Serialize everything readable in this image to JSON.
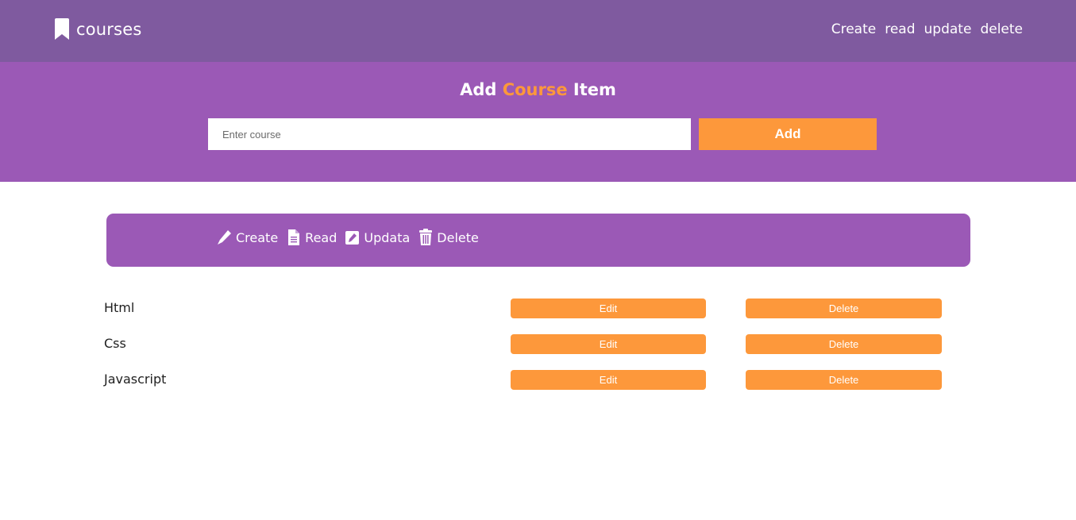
{
  "navbar": {
    "brand": "courses",
    "links": [
      "Create",
      "read",
      "update",
      "delete"
    ]
  },
  "hero": {
    "title_start": "Add",
    "title_accent": "Course",
    "title_end": "Item",
    "input_placeholder": "Enter course",
    "input_value": "",
    "add_label": "Add"
  },
  "crud": {
    "items": [
      {
        "label": "Create",
        "icon": "pencil-icon"
      },
      {
        "label": "Read",
        "icon": "file-icon"
      },
      {
        "label": "Updata",
        "icon": "edit-square-icon"
      },
      {
        "label": "Delete",
        "icon": "trash-icon"
      }
    ]
  },
  "courses": [
    {
      "name": "Html",
      "edit_label": "Edit",
      "delete_label": "Delete"
    },
    {
      "name": "Css",
      "edit_label": "Edit",
      "delete_label": "Delete"
    },
    {
      "name": "Javascript",
      "edit_label": "Edit",
      "delete_label": "Delete"
    }
  ],
  "colors": {
    "navbar": "#7f5a9f",
    "primary": "#9b59b6",
    "accent": "#fd983b",
    "text": "#1f1f1f"
  }
}
